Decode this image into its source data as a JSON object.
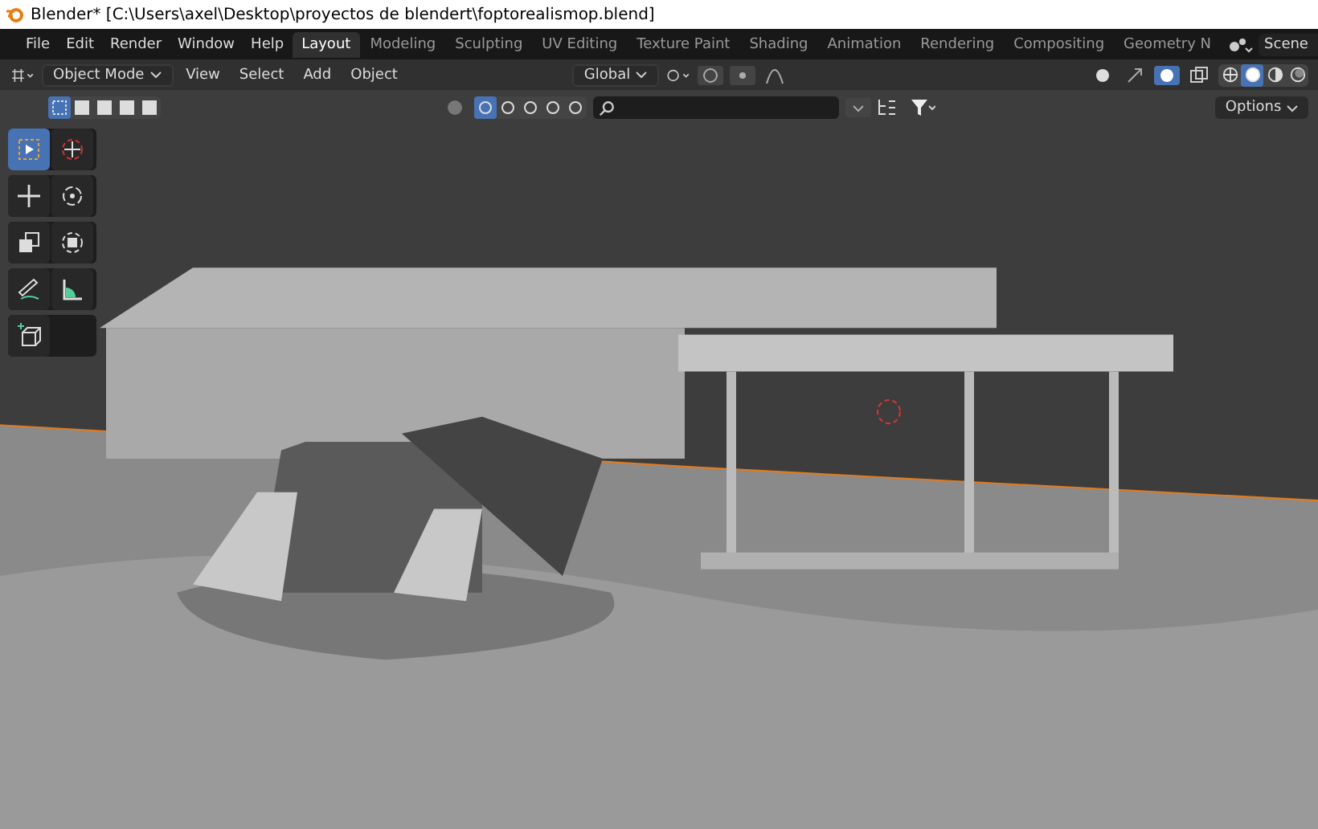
{
  "window": {
    "title": "Blender* [C:\\Users\\axel\\Desktop\\proyectos de blendert\\foptorealismop.blend]"
  },
  "menu": [
    "File",
    "Edit",
    "Render",
    "Window",
    "Help"
  ],
  "workspaces": [
    {
      "label": "Layout",
      "selected": true
    },
    {
      "label": "Modeling",
      "selected": false
    },
    {
      "label": "Sculpting",
      "selected": false
    },
    {
      "label": "UV Editing",
      "selected": false
    },
    {
      "label": "Texture Paint",
      "selected": false
    },
    {
      "label": "Shading",
      "selected": false
    },
    {
      "label": "Animation",
      "selected": false
    },
    {
      "label": "Rendering",
      "selected": false
    },
    {
      "label": "Compositing",
      "selected": false
    },
    {
      "label": "Geometry N",
      "selected": false
    }
  ],
  "scene": {
    "value": "Scene"
  },
  "header": {
    "mode": "Object Mode",
    "menus": [
      "View",
      "Select",
      "Add",
      "Object"
    ],
    "orientation": "Global",
    "shading": [
      {
        "kind": "wire",
        "selected": false
      },
      {
        "kind": "solid",
        "selected": true
      },
      {
        "kind": "material",
        "selected": false
      },
      {
        "kind": "rendered",
        "selected": false
      }
    ]
  },
  "selection_modes": [
    {
      "selected": true
    },
    {
      "selected": false
    },
    {
      "selected": false
    },
    {
      "selected": false
    },
    {
      "selected": false
    }
  ],
  "options": "Options",
  "tools": [
    {
      "kind": "select",
      "selected": true
    },
    {
      "kind": "cursor",
      "selected": false
    },
    {
      "kind": "move",
      "selected": false
    },
    {
      "kind": "rotate",
      "selected": false
    },
    {
      "kind": "scale",
      "selected": false
    },
    {
      "kind": "transform",
      "selected": false
    },
    {
      "kind": "annotate",
      "selected": false
    },
    {
      "kind": "measure",
      "selected": false
    },
    {
      "kind": "add-cube",
      "selected": false
    }
  ]
}
